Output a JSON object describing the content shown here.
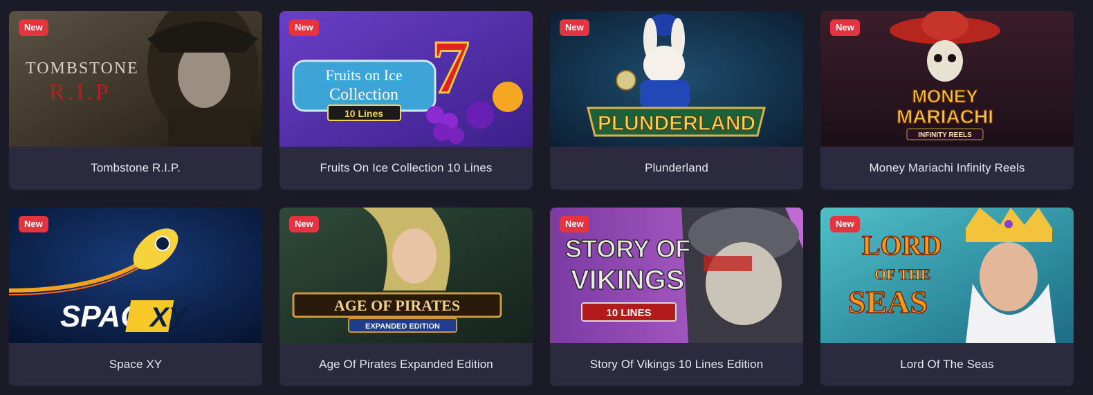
{
  "games": [
    {
      "title": "Tombstone R.I.P.",
      "badge": "New",
      "art_text": [
        "TOMBSTONE",
        "R.I.P"
      ]
    },
    {
      "title": "Fruits On Ice Collection 10 Lines",
      "badge": "New",
      "art_text": [
        "Fruits on Ice",
        "Collection",
        "10 Lines"
      ]
    },
    {
      "title": "Plunderland",
      "badge": "New",
      "art_text": [
        "PLUNDERLAND"
      ]
    },
    {
      "title": "Money Mariachi Infinity Reels",
      "badge": "New",
      "art_text": [
        "MONEY",
        "MARIACHI",
        "INFINITY REELS"
      ]
    },
    {
      "title": "Space XY",
      "badge": "New",
      "art_text": [
        "SPACE",
        "XY"
      ]
    },
    {
      "title": "Age Of Pirates Expanded Edition",
      "badge": "New",
      "art_text": [
        "AGE OF PIRATES",
        "EXPANDED EDITION"
      ]
    },
    {
      "title": "Story Of Vikings 10 Lines Edition",
      "badge": "New",
      "art_text": [
        "STORY OF",
        "VIKINGS",
        "10 LINES"
      ]
    },
    {
      "title": "Lord Of The Seas",
      "badge": "New",
      "art_text": [
        "LORD",
        "OF THE",
        "SEAS"
      ]
    }
  ],
  "colors": {
    "page_bg": "#1b1a27",
    "card_bg": "#2b2a3e",
    "badge_bg": "#e5333f",
    "title_text": "#e6e6ef"
  }
}
